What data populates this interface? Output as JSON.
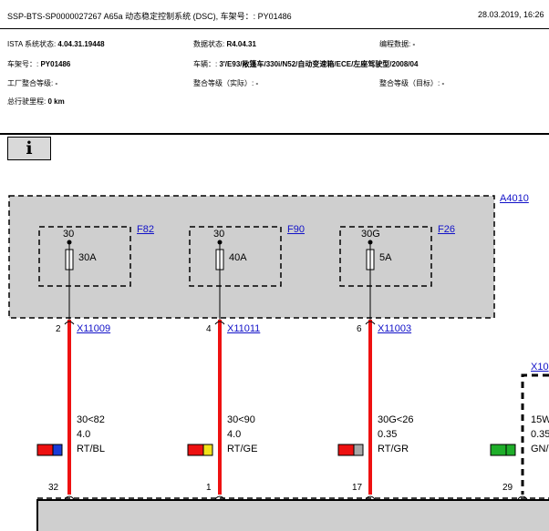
{
  "header": {
    "title": "SSP-BTS-SP0000027267 A65a 动态稳定控制系统 (DSC), 车架号：: PY01486",
    "date": "28.03.2019, 16:26"
  },
  "info": {
    "ista_label": "ISTA 系统状态: ",
    "ista_value": "4.04.31.19448",
    "data_label": "数据状态: ",
    "data_value": "R4.04.31",
    "prog_label": "编程数据: ",
    "prog_value": "-",
    "vin_label": "车架号：: ",
    "vin_value": "PY01486",
    "vehicle_label": "车辆：: ",
    "vehicle_value": "3'/E93/敞篷车/330i/N52/自动变速箱/ECE/左座驾驶型/2008/04",
    "factory_label": "工厂整合等级: ",
    "factory_value": "-",
    "actual_label": "整合等级（实际）: ",
    "actual_value": "-",
    "target_label": "整合等级（目标）: ",
    "target_value": "-",
    "mileage_label": "总行驶里程: ",
    "mileage_value": "0 km"
  },
  "info_button": {
    "label": "i"
  },
  "diagram": {
    "module_link": "A4010",
    "fuses": [
      {
        "link": "F82",
        "terminal": "30",
        "rating": "30A",
        "pin": "2",
        "connector": "X11009",
        "wire": [
          "30<82",
          "4.0",
          "RT/BL"
        ],
        "bottom_pin": "32",
        "colors": [
          "#ee1111",
          "#1a3cd8"
        ]
      },
      {
        "link": "F90",
        "terminal": "30",
        "rating": "40A",
        "pin": "4",
        "connector": "X11011",
        "wire": [
          "30<90",
          "4.0",
          "RT/GE"
        ],
        "bottom_pin": "1",
        "colors": [
          "#ee1111",
          "#f2e21a"
        ]
      },
      {
        "link": "F26",
        "terminal": "30G",
        "rating": "5A",
        "pin": "6",
        "connector": "X11003",
        "wire": [
          "30G<26",
          "0.35",
          "RT/GR"
        ],
        "bottom_pin": "17",
        "colors": [
          "#ee1111",
          "#a8a8a8"
        ]
      }
    ],
    "right_connector": "X10",
    "right_wire": [
      "15W",
      "0.35",
      "GN/"
    ],
    "right_bottom_pin": "29",
    "right_colors": [
      "#1fae2a",
      "#1fae2a"
    ],
    "wire_color": "#ee1111"
  }
}
